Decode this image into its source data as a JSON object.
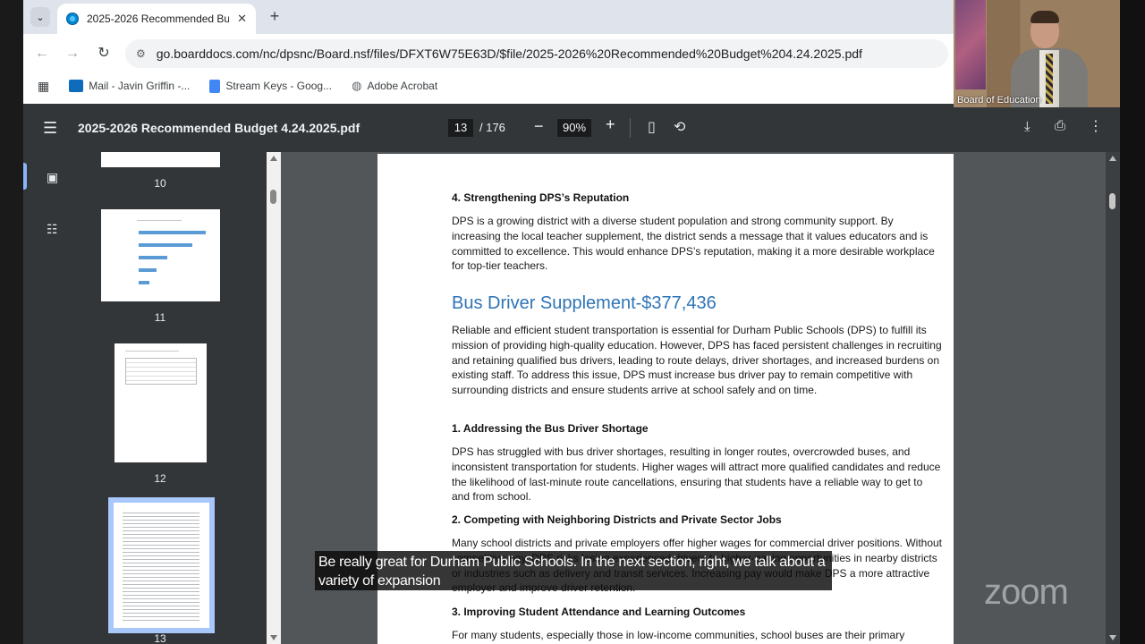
{
  "browser": {
    "tab": {
      "title": "2025-2026 Recommended Bud",
      "close": "✕"
    },
    "new_tab": "+",
    "url": "go.boarddocs.com/nc/dpsnc/Board.nsf/files/DFXT6W75E63D/$file/2025-2026%20Recommended%20Budget%204.24.2025.pdf",
    "bookmarks": [
      {
        "label": "Mail - Javin Griffin -...",
        "icon": "outlook-icon",
        "color": "#0f6cbd"
      },
      {
        "label": "Stream Keys - Goog...",
        "icon": "docs-icon",
        "color": "#4285f4"
      },
      {
        "label": "Adobe Acrobat",
        "icon": "globe-icon",
        "color": "#5f6368"
      }
    ]
  },
  "pdf": {
    "title": "2025-2026 Recommended Budget 4.24.2025.pdf",
    "current_page": "13",
    "total_pages": "/ 176",
    "zoom": "90%",
    "thumbnails": [
      {
        "num": "10"
      },
      {
        "num": "11"
      },
      {
        "num": "12"
      },
      {
        "num": "13",
        "selected": true
      }
    ]
  },
  "document": {
    "h4": "4. Strengthening DPS’s Reputation",
    "p4": "DPS is a growing district with a diverse student population and strong community support. By increasing the local teacher supplement, the district sends a message that it values educators and is committed to excellence. This would enhance DPS’s reputation, making it a more desirable workplace for top-tier teachers.",
    "section_title": "Bus Driver Supplement-$377,436",
    "intro": "Reliable and efficient student transportation is essential for Durham Public Schools (DPS) to fulfill its mission of providing high-quality education. However, DPS has faced persistent challenges in recruiting and retaining qualified bus drivers, leading to route delays, driver shortages, and increased burdens on existing staff. To address this issue, DPS must increase bus driver pay to remain competitive with surrounding districts and ensure students arrive at school safely and on time.",
    "h1": "1. Addressing the Bus Driver Shortage",
    "p1": "DPS has struggled with bus driver shortages, resulting in longer routes, overcrowded buses, and inconsistent transportation for students. Higher wages will attract more qualified candidates and reduce the likelihood of last-minute route cancellations, ensuring that students have a reliable way to get to and from school.",
    "h2": "2. Competing with Neighboring Districts and Private Sector Jobs",
    "p2": "Many school districts and private employers offer higher wages for commercial driver positions. Without competitive pay, DPS risks losing experienced drivers to higher-paying opportunities in nearby districts or industries such as delivery and transit services. Increasing pay would make DPS a more attractive employer and improve driver retention.",
    "h3": "3. Improving Student Attendance and Learning Outcomes",
    "p3": "For many students, especially those in low-income communities, school buses are their primary"
  },
  "video": {
    "label": "Board of Education"
  },
  "caption": "Be really great for Durham Public Schools. In the next section, right, we talk about a variety of expansion",
  "zoom_logo": "zoom"
}
